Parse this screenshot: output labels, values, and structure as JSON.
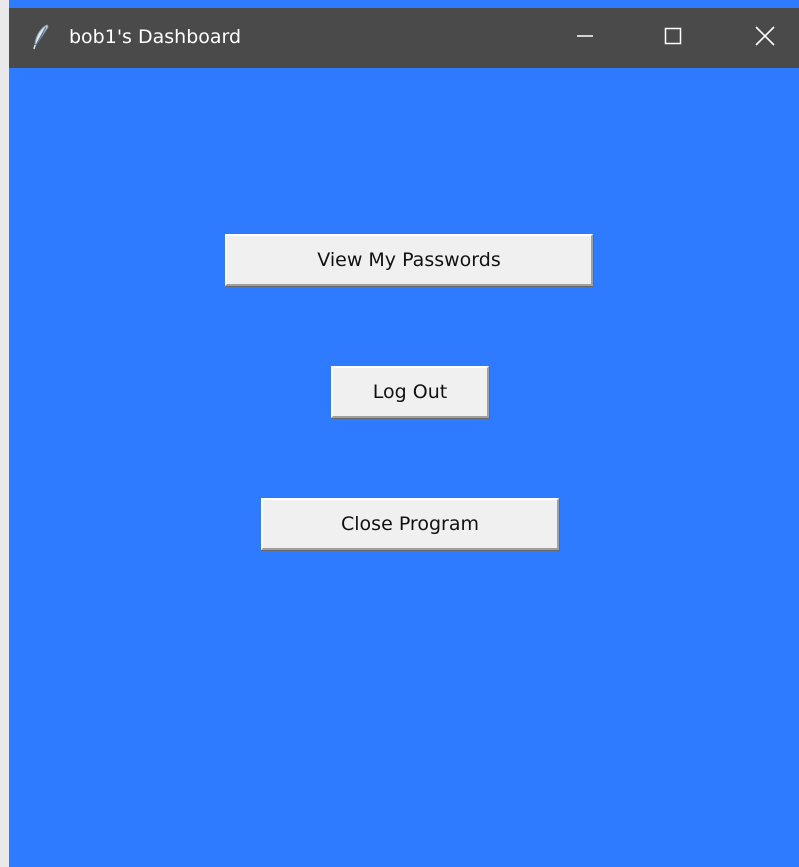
{
  "window": {
    "title": "bob1's Dashboard",
    "app_icon": "feather-icon",
    "controls": {
      "minimize_icon": "minimize-icon",
      "maximize_icon": "maximize-icon",
      "close_icon": "close-icon"
    }
  },
  "dashboard": {
    "background_color": "#2f7bff",
    "buttons": {
      "view_passwords": "View My Passwords",
      "log_out": "Log Out",
      "close_program": "Close Program"
    }
  },
  "colors": {
    "titlebar": "#4a4a4a",
    "button_face": "#f0f0f0"
  }
}
